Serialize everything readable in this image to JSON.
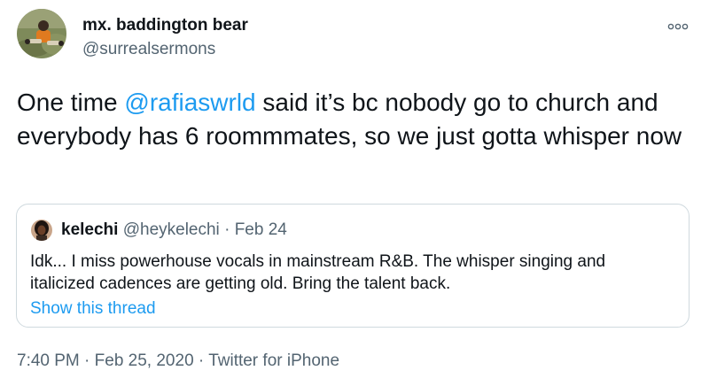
{
  "author": {
    "display_name": "mx. baddington bear",
    "handle": "@surrealsermons",
    "avatar_icon": "profile-photo-icon"
  },
  "more_menu_icon": "more-options-icon",
  "tweet": {
    "text_before": "One time ",
    "mention": "@rafiaswrld",
    "text_after": " said it’s bc nobody go to church and everybody has 6 roommmates, so we just gotta whisper now"
  },
  "quoted": {
    "display_name": "kelechi",
    "handle": "@heykelechi",
    "separator": "·",
    "date": "Feb 24",
    "text": "Idk... I miss powerhouse vocals in mainstream R&B. The whisper singing and italicized cadences are getting old. Bring the talent back.",
    "thread_link": "Show this thread",
    "avatar_icon": "profile-photo-icon"
  },
  "meta": {
    "time": "7:40 PM",
    "sep1": " · ",
    "date": "Feb 25, 2020",
    "sep2": " · ",
    "source": "Twitter for iPhone"
  },
  "colors": {
    "link": "#1d9bf0",
    "secondary_text": "#536471",
    "primary_text": "#0f1419",
    "border": "#cfd9de"
  }
}
